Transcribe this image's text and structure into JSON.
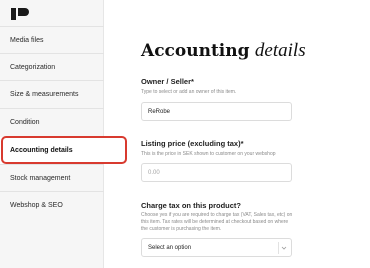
{
  "sidebar": {
    "items": [
      {
        "label": "Media files"
      },
      {
        "label": "Categorization"
      },
      {
        "label": "Size & measurements"
      },
      {
        "label": "Condition"
      },
      {
        "label": "Accounting details",
        "active": true
      },
      {
        "label": "Stock management"
      },
      {
        "label": "Webshop & SEO"
      }
    ]
  },
  "main": {
    "title_part1": "Accounting",
    "title_part2": "details",
    "owner": {
      "label": "Owner / Seller*",
      "hint": "Type to select or add an owner of this item.",
      "value": "ReRobe"
    },
    "price": {
      "label": "Listing price (excluding tax)*",
      "hint": "This is the price in SEK shown to customer on your webshop",
      "placeholder": "0.00"
    },
    "tax": {
      "label": "Charge tax on this product?",
      "hint": "Choose yes if you are required to charge tax (VAT, Sales tax, etc) on this item. Tax rates will be determined at checkout based on where the customer is purchasing the item.",
      "select_value": "Select an option"
    }
  },
  "colors": {
    "highlight": "#d83a2f",
    "sidebar_bg": "#f6f6f6"
  }
}
